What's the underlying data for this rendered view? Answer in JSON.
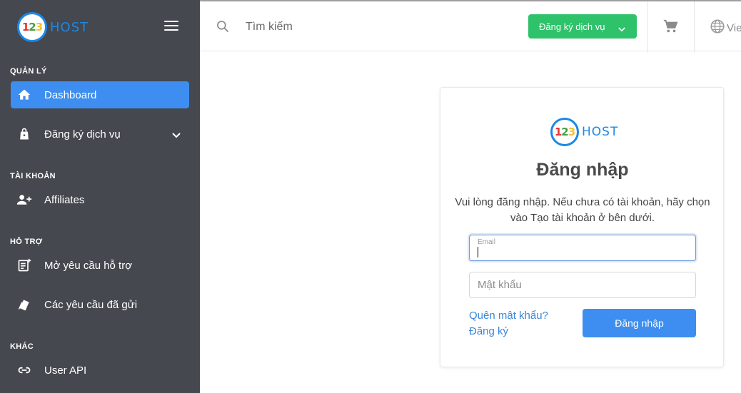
{
  "brand": {
    "digits": [
      "1",
      "2",
      "3"
    ],
    "name": "HOST"
  },
  "sidebar": {
    "sections": [
      {
        "label": "QUẢN LÝ"
      },
      {
        "label": "TÀI KHOẢN"
      },
      {
        "label": "HỖ TRỢ"
      },
      {
        "label": "KHÁC"
      }
    ],
    "items": [
      {
        "label": "Dashboard",
        "icon": "home-icon",
        "active": true
      },
      {
        "label": "Đăng ký dịch vụ",
        "icon": "shopping-bag-icon"
      },
      {
        "label": "Affiliates",
        "icon": "user-plus-icon"
      },
      {
        "label": "Mở yêu cầu hỗ trợ",
        "icon": "new-ticket-icon"
      },
      {
        "label": "Các yêu cầu đã gửi",
        "icon": "tickets-icon"
      },
      {
        "label": "User API",
        "icon": "link-icon"
      }
    ]
  },
  "topbar": {
    "search_placeholder": "Tìm kiếm",
    "register_button": "Đăng ký dịch vụ",
    "language": "Vie"
  },
  "login": {
    "title": "Đăng nhập",
    "description": "Vui lòng đăng nhập. Nếu chưa có tài khoản, hãy chọn vào Tạo tài khoản ở bên dưới.",
    "email_label": "Email",
    "email_value": "",
    "password_placeholder": "Mật khẩu",
    "forgot_link": "Quên mật khẩu?",
    "register_link": "Đăng ký",
    "submit_button": "Đăng nhập"
  },
  "colors": {
    "sidebar_bg": "#45484e",
    "accent": "#3d8ef0",
    "register_green": "#2ec36b",
    "link": "#3a86d8"
  }
}
